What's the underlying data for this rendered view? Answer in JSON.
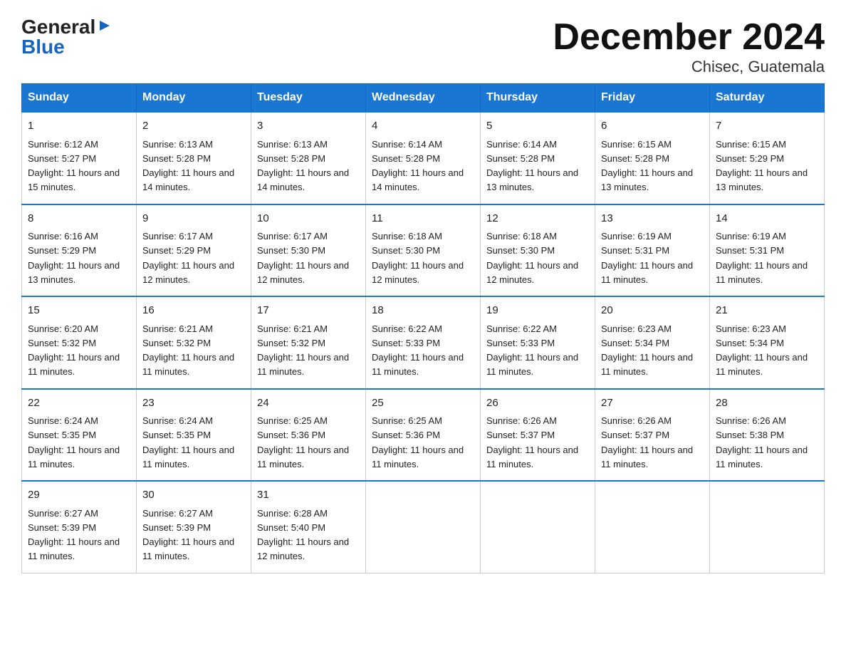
{
  "logo": {
    "general": "General",
    "triangle": "▶",
    "blue": "Blue"
  },
  "title": "December 2024",
  "subtitle": "Chisec, Guatemala",
  "days_of_week": [
    "Sunday",
    "Monday",
    "Tuesday",
    "Wednesday",
    "Thursday",
    "Friday",
    "Saturday"
  ],
  "weeks": [
    [
      {
        "day": "1",
        "sunrise": "6:12 AM",
        "sunset": "5:27 PM",
        "daylight": "11 hours and 15 minutes."
      },
      {
        "day": "2",
        "sunrise": "6:13 AM",
        "sunset": "5:28 PM",
        "daylight": "11 hours and 14 minutes."
      },
      {
        "day": "3",
        "sunrise": "6:13 AM",
        "sunset": "5:28 PM",
        "daylight": "11 hours and 14 minutes."
      },
      {
        "day": "4",
        "sunrise": "6:14 AM",
        "sunset": "5:28 PM",
        "daylight": "11 hours and 14 minutes."
      },
      {
        "day": "5",
        "sunrise": "6:14 AM",
        "sunset": "5:28 PM",
        "daylight": "11 hours and 13 minutes."
      },
      {
        "day": "6",
        "sunrise": "6:15 AM",
        "sunset": "5:28 PM",
        "daylight": "11 hours and 13 minutes."
      },
      {
        "day": "7",
        "sunrise": "6:15 AM",
        "sunset": "5:29 PM",
        "daylight": "11 hours and 13 minutes."
      }
    ],
    [
      {
        "day": "8",
        "sunrise": "6:16 AM",
        "sunset": "5:29 PM",
        "daylight": "11 hours and 13 minutes."
      },
      {
        "day": "9",
        "sunrise": "6:17 AM",
        "sunset": "5:29 PM",
        "daylight": "11 hours and 12 minutes."
      },
      {
        "day": "10",
        "sunrise": "6:17 AM",
        "sunset": "5:30 PM",
        "daylight": "11 hours and 12 minutes."
      },
      {
        "day": "11",
        "sunrise": "6:18 AM",
        "sunset": "5:30 PM",
        "daylight": "11 hours and 12 minutes."
      },
      {
        "day": "12",
        "sunrise": "6:18 AM",
        "sunset": "5:30 PM",
        "daylight": "11 hours and 12 minutes."
      },
      {
        "day": "13",
        "sunrise": "6:19 AM",
        "sunset": "5:31 PM",
        "daylight": "11 hours and 11 minutes."
      },
      {
        "day": "14",
        "sunrise": "6:19 AM",
        "sunset": "5:31 PM",
        "daylight": "11 hours and 11 minutes."
      }
    ],
    [
      {
        "day": "15",
        "sunrise": "6:20 AM",
        "sunset": "5:32 PM",
        "daylight": "11 hours and 11 minutes."
      },
      {
        "day": "16",
        "sunrise": "6:21 AM",
        "sunset": "5:32 PM",
        "daylight": "11 hours and 11 minutes."
      },
      {
        "day": "17",
        "sunrise": "6:21 AM",
        "sunset": "5:32 PM",
        "daylight": "11 hours and 11 minutes."
      },
      {
        "day": "18",
        "sunrise": "6:22 AM",
        "sunset": "5:33 PM",
        "daylight": "11 hours and 11 minutes."
      },
      {
        "day": "19",
        "sunrise": "6:22 AM",
        "sunset": "5:33 PM",
        "daylight": "11 hours and 11 minutes."
      },
      {
        "day": "20",
        "sunrise": "6:23 AM",
        "sunset": "5:34 PM",
        "daylight": "11 hours and 11 minutes."
      },
      {
        "day": "21",
        "sunrise": "6:23 AM",
        "sunset": "5:34 PM",
        "daylight": "11 hours and 11 minutes."
      }
    ],
    [
      {
        "day": "22",
        "sunrise": "6:24 AM",
        "sunset": "5:35 PM",
        "daylight": "11 hours and 11 minutes."
      },
      {
        "day": "23",
        "sunrise": "6:24 AM",
        "sunset": "5:35 PM",
        "daylight": "11 hours and 11 minutes."
      },
      {
        "day": "24",
        "sunrise": "6:25 AM",
        "sunset": "5:36 PM",
        "daylight": "11 hours and 11 minutes."
      },
      {
        "day": "25",
        "sunrise": "6:25 AM",
        "sunset": "5:36 PM",
        "daylight": "11 hours and 11 minutes."
      },
      {
        "day": "26",
        "sunrise": "6:26 AM",
        "sunset": "5:37 PM",
        "daylight": "11 hours and 11 minutes."
      },
      {
        "day": "27",
        "sunrise": "6:26 AM",
        "sunset": "5:37 PM",
        "daylight": "11 hours and 11 minutes."
      },
      {
        "day": "28",
        "sunrise": "6:26 AM",
        "sunset": "5:38 PM",
        "daylight": "11 hours and 11 minutes."
      }
    ],
    [
      {
        "day": "29",
        "sunrise": "6:27 AM",
        "sunset": "5:39 PM",
        "daylight": "11 hours and 11 minutes."
      },
      {
        "day": "30",
        "sunrise": "6:27 AM",
        "sunset": "5:39 PM",
        "daylight": "11 hours and 11 minutes."
      },
      {
        "day": "31",
        "sunrise": "6:28 AM",
        "sunset": "5:40 PM",
        "daylight": "11 hours and 12 minutes."
      },
      null,
      null,
      null,
      null
    ]
  ]
}
